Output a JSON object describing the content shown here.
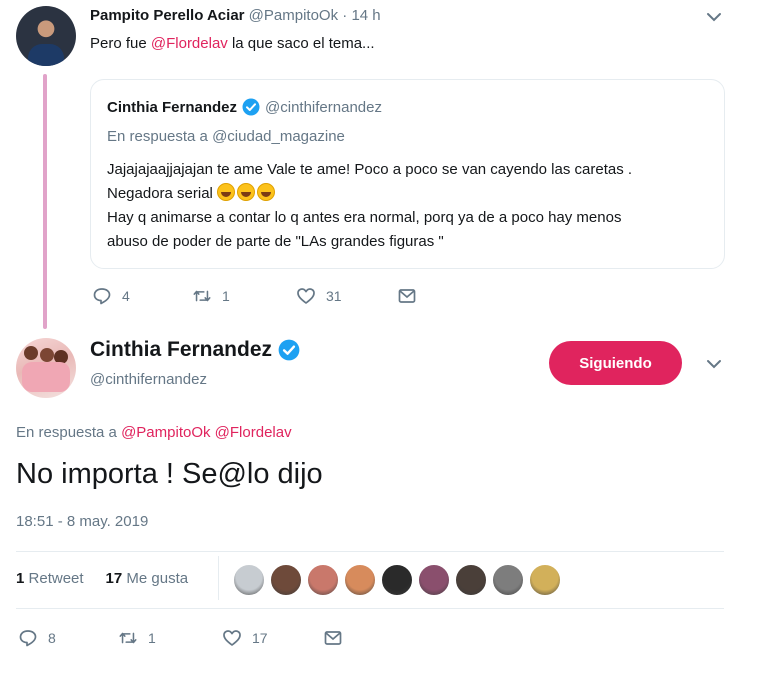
{
  "top_tweet": {
    "name": "Pampito Perello Aciar",
    "handle": "@PampitoOk",
    "separator": "·",
    "time": "14 h",
    "text_prefix": "Pero fue ",
    "text_mention": "@Flordelav",
    "text_suffix": " la que saco el tema...",
    "quote": {
      "name": "Cinthia Fernandez",
      "handle": "@cinthifernandez",
      "reply_prefix": "En respuesta a ",
      "reply_to": "@ciudad_magazine",
      "body_line1": "Jajajajaajjajajan te ame Vale te ame! Poco a poco se van cayendo las caretas .",
      "body_line2": "Negadora serial ",
      "body_line3": "Hay q animarse a contar lo q antes era normal, porq ya de a poco hay menos",
      "body_line4": "abuso de poder de parte de \"LAs grandes figuras \"",
      "emojis": [
        "grinning-squinting-face",
        "grinning-squinting-face",
        "grinning-squinting-face"
      ]
    },
    "actions": {
      "replies": "4",
      "retweets": "1",
      "likes": "31"
    }
  },
  "main_tweet": {
    "name": "Cinthia Fernandez",
    "handle": "@cinthifernandez",
    "follow_label": "Siguiendo",
    "reply_prefix": "En respuesta a ",
    "reply_to_1": "@PampitoOk",
    "reply_to_2": "@Flordelav",
    "text": "No importa ! Se@lo dijo",
    "timestamp": "18:51 - 8 may. 2019",
    "stats": {
      "retweets_count": "1",
      "retweets_label": "Retweet",
      "likes_count": "17",
      "likes_label": "Me gusta"
    },
    "actions": {
      "replies": "8",
      "retweets": "1",
      "likes": "17"
    }
  },
  "colors": {
    "accent": "#e0245e",
    "verified": "#1da1f2",
    "muted_text": "#657786",
    "thread_line": "#e1a3c9"
  },
  "liker_avatar_colors": [
    "#c7ccd1",
    "#6e4a3a",
    "#c9786b",
    "#d78b5c",
    "#2a2a2a",
    "#8a4f6d",
    "#4a3f39",
    "#7d7d7d",
    "#d2b05a"
  ]
}
